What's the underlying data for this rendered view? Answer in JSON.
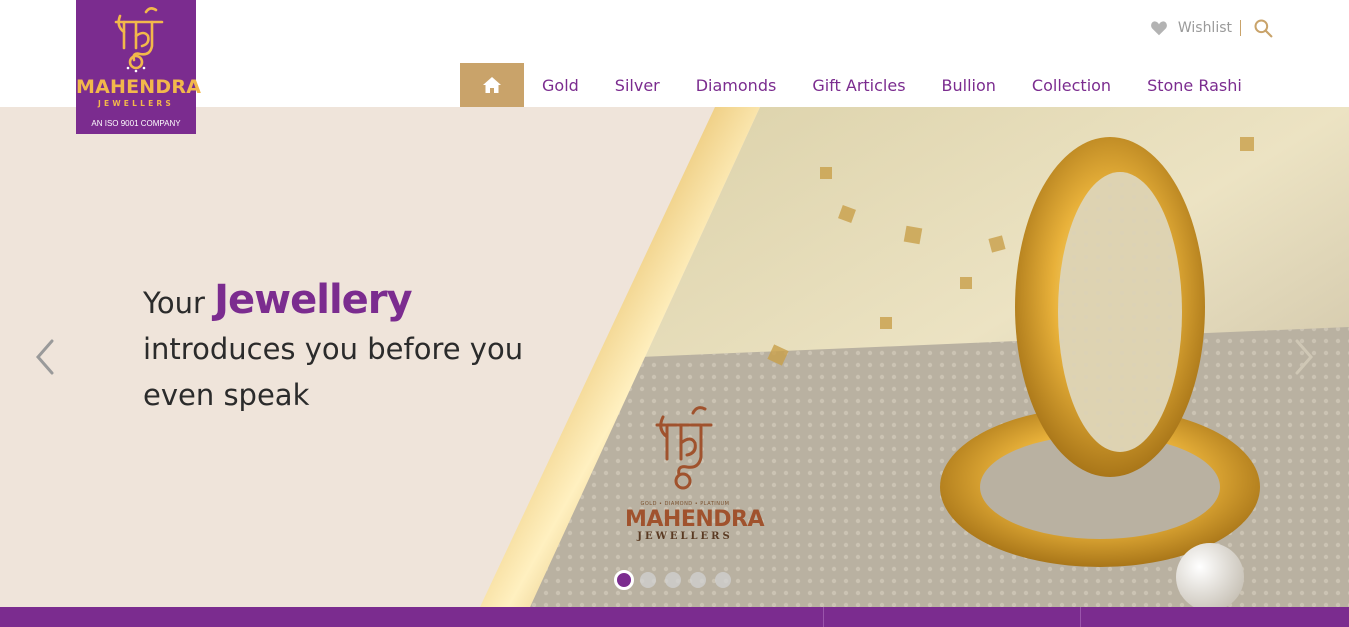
{
  "brand": {
    "name": "MAHENDRA",
    "subname": "JEWELLERS",
    "iso": "AN ISO 9001 COMPANY",
    "colors": {
      "purple": "#7b2c8f",
      "gold": "#c9a36a",
      "logo_gold": "#f2b84b"
    }
  },
  "utility": {
    "wishlist_label": "Wishlist",
    "icons": [
      "heart-icon",
      "search-icon"
    ]
  },
  "nav": {
    "home_icon": "home-icon",
    "items": [
      "Gold",
      "Silver",
      "Diamonds",
      "Gift Articles",
      "Bullion",
      "Collection",
      "Stone Rashi"
    ]
  },
  "hero": {
    "headline_prefix": "Your",
    "headline_accent": "Jewellery",
    "headline_line2": "introduces you before you",
    "headline_line3": "even speak",
    "brandmark_tagline": "GOLD • DIAMOND • PLATINUM",
    "brandmark_name": "MAHENDRA",
    "brandmark_sub": "JEWELLERS",
    "slides_total": 5,
    "active_slide": 1
  }
}
